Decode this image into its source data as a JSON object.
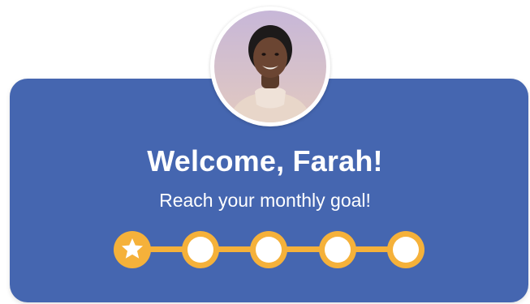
{
  "profile": {
    "greeting": "Welcome, Farah!",
    "subtitle": "Reach your monthly goal!",
    "avatar_icon": "user-avatar-photo"
  },
  "goal_progress": {
    "total_steps": 5,
    "completed_steps": 1,
    "completed_icon": "star-icon"
  },
  "colors": {
    "card_background": "#4566b0",
    "accent": "#f5b13a",
    "text": "#ffffff"
  }
}
